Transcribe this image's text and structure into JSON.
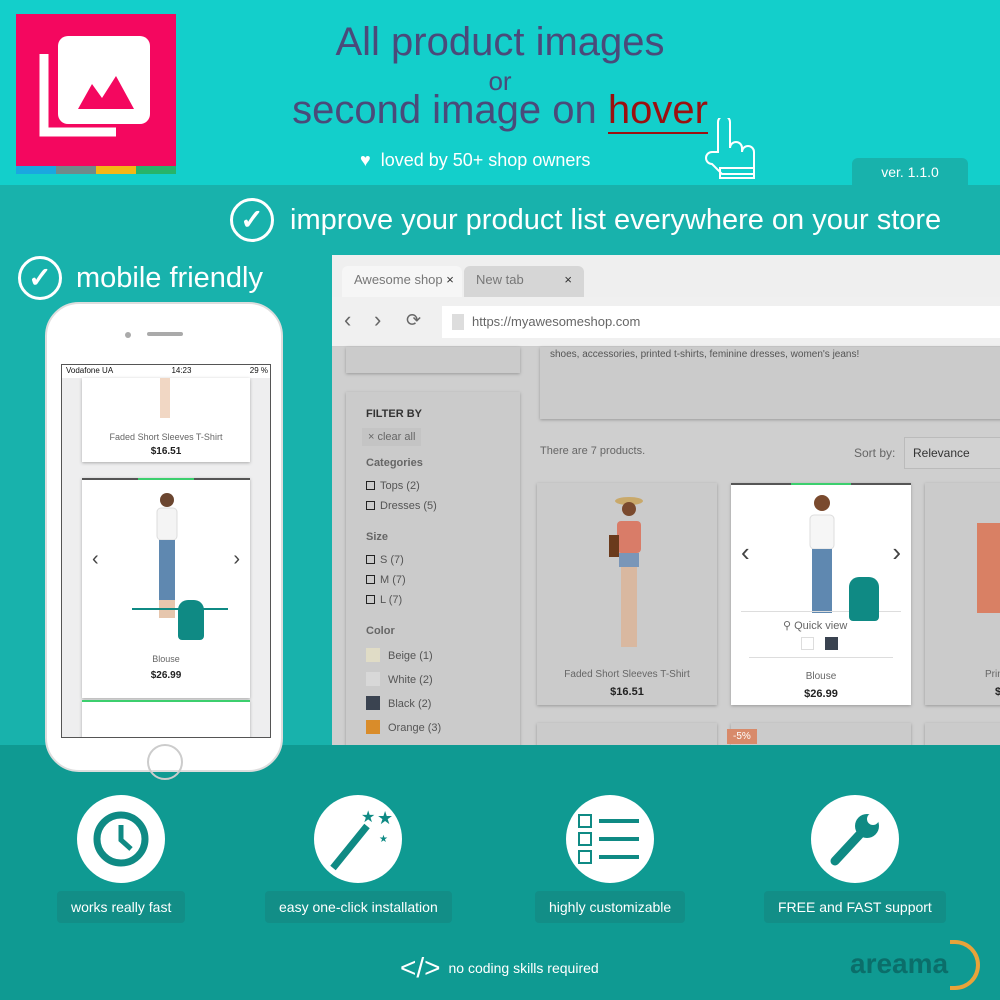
{
  "header": {
    "title_line1": "All product images",
    "title_or": "or",
    "title_line2_prefix": "second image on ",
    "title_highlight": "hover",
    "loved": "loved by 50+ shop owners",
    "version": "ver. 1.1.0"
  },
  "features_top": {
    "improve": "improve your product list everywhere on your store",
    "mobile": "mobile friendly"
  },
  "phone": {
    "carrier": "Vodafone UA",
    "time": "14:23",
    "battery": "29 %",
    "products": [
      {
        "name": "Faded Short Sleeves T-Shirt",
        "price": "$16.51"
      },
      {
        "name": "Blouse",
        "price": "$26.99"
      }
    ]
  },
  "browser": {
    "tabs": [
      {
        "label": "Awesome shop",
        "close": "×"
      },
      {
        "label": "New tab",
        "close": "×"
      }
    ],
    "url": "https://myawesomeshop.com",
    "description": "shoes, accessories, printed t-shirts, feminine dresses, women's jeans!",
    "product_count": "There are 7 products.",
    "sort_label": "Sort by:",
    "sort_value": "Relevance",
    "filters": {
      "title": "FILTER BY",
      "clear": "clear all",
      "categories_label": "Categories",
      "categories": [
        "Tops (2)",
        "Dresses (5)"
      ],
      "size_label": "Size",
      "sizes": [
        "S (7)",
        "M (7)",
        "L (7)"
      ],
      "color_label": "Color",
      "colors": [
        {
          "label": "Beige (1)",
          "hex": "#e0dcc6"
        },
        {
          "label": "White (2)",
          "hex": "#d8d8d8"
        },
        {
          "label": "Black (2)",
          "hex": "#3a4350"
        },
        {
          "label": "Orange (3)",
          "hex": "#d98c2a"
        }
      ]
    },
    "products": [
      {
        "name": "Faded Short Sleeves T-Shirt",
        "price": "$16.51"
      },
      {
        "name": "Blouse",
        "price": "$26.99",
        "quick_view": "Quick view"
      },
      {
        "name": "Prin",
        "price": "$"
      }
    ],
    "discount": "-5%"
  },
  "features": [
    {
      "label": "works really fast",
      "icon": "clock-icon"
    },
    {
      "label": "easy one-click installation",
      "icon": "magic-wand-icon"
    },
    {
      "label": "highly customizable",
      "icon": "checklist-icon"
    },
    {
      "label": "FREE and FAST support",
      "icon": "wrench-icon"
    }
  ],
  "footer": {
    "no_code": "no coding skills required",
    "brand": "areama"
  },
  "colors": {
    "top_bg": "#13cfcb",
    "mid_bg": "#18b2ac",
    "bottom_bg": "#0f9a92",
    "logo": "#f4075f",
    "accent_teal": "#0f8a84",
    "hover_red": "#9b1010"
  }
}
